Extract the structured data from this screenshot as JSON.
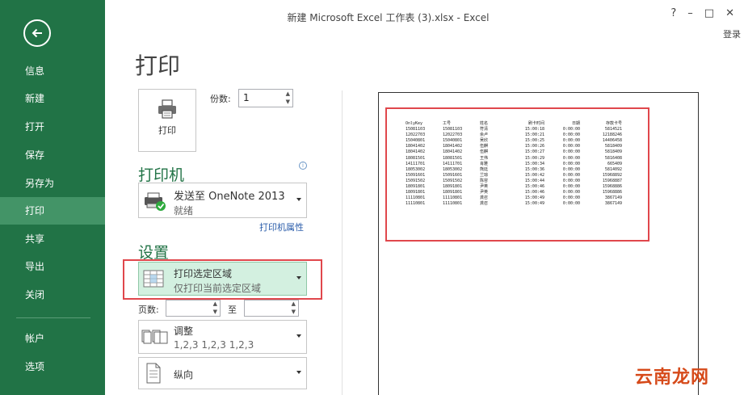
{
  "window": {
    "title": "新建 Microsoft Excel 工作表 (3).xlsx - Excel",
    "controls": [
      "?",
      "–",
      "□",
      "✕"
    ],
    "login": "登录"
  },
  "sidebar": {
    "items": [
      {
        "label": "信息"
      },
      {
        "label": "新建"
      },
      {
        "label": "打开"
      },
      {
        "label": "保存"
      },
      {
        "label": "另存为"
      },
      {
        "label": "打印",
        "active": true
      },
      {
        "label": "共享"
      },
      {
        "label": "导出"
      },
      {
        "label": "关闭"
      },
      {
        "label": "帐户"
      },
      {
        "label": "选项"
      }
    ]
  },
  "print": {
    "title": "打印",
    "button_label": "打印",
    "copies_label": "份数:",
    "copies_value": "1"
  },
  "printer": {
    "section_title": "打印机",
    "name": "发送至 OneNote 2013",
    "status": "就绪",
    "properties_link": "打印机属性"
  },
  "settings": {
    "section_title": "设置",
    "selection_title": "打印选定区域",
    "selection_sub": "仅打印当前选定区域",
    "pages_label": "页数:",
    "to_label": "至",
    "collate_title": "调整",
    "collate_sub": "1,2,3    1,2,3    1,2,3",
    "orientation": "纵向"
  },
  "preview": {
    "headers": [
      "OnlyKey",
      "工号",
      "姓名",
      "刷卡时间",
      "日期",
      "存款卡号"
    ],
    "rows": [
      [
        "15081103",
        "15081103",
        "符清",
        "15:00:18",
        "0:00:00",
        "5814521"
      ],
      [
        "12022703",
        "12022703",
        "余卢",
        "15:00:21",
        "0:00:00",
        "12188246"
      ],
      [
        "15040801",
        "15040801",
        "吴欣",
        "15:00:25",
        "0:00:00",
        "14406458"
      ],
      [
        "18041402",
        "18041402",
        "伍麒",
        "15:00:26",
        "0:00:00",
        "5818409"
      ],
      [
        "18041402",
        "18041402",
        "伍麒",
        "15:00:27",
        "0:00:00",
        "5818409"
      ],
      [
        "18081501",
        "18081501",
        "王伟",
        "15:00:29",
        "0:00:00",
        "5816408"
      ],
      [
        "14111701",
        "14111701",
        "肖雅",
        "15:00:34",
        "0:00:00",
        "665409"
      ],
      [
        "18053002",
        "18053002",
        "熊廷",
        "15:00:36",
        "0:00:00",
        "5814092"
      ],
      [
        "15091601",
        "15091601",
        "兰琼",
        "15:00:42",
        "0:00:00",
        "15968892"
      ],
      [
        "15091502",
        "15091502",
        "陈容",
        "15:00:44",
        "0:00:00",
        "15968887"
      ],
      [
        "18091801",
        "18091801",
        "尹英",
        "15:00:46",
        "0:00:00",
        "15968886"
      ],
      [
        "18091801",
        "18091801",
        "尹英",
        "15:00:46",
        "0:00:00",
        "15968886"
      ],
      [
        "11110801",
        "11110801",
        "龚召",
        "15:00:49",
        "0:00:00",
        "3867149"
      ],
      [
        "11110801",
        "11110801",
        "龚召",
        "15:00:49",
        "0:00:00",
        "3867149"
      ]
    ]
  },
  "watermark": "云南龙网",
  "colors": {
    "sidebar": "#217346",
    "sidebar_active": "#439467",
    "accent": "#217346",
    "highlight": "#e0474c"
  }
}
